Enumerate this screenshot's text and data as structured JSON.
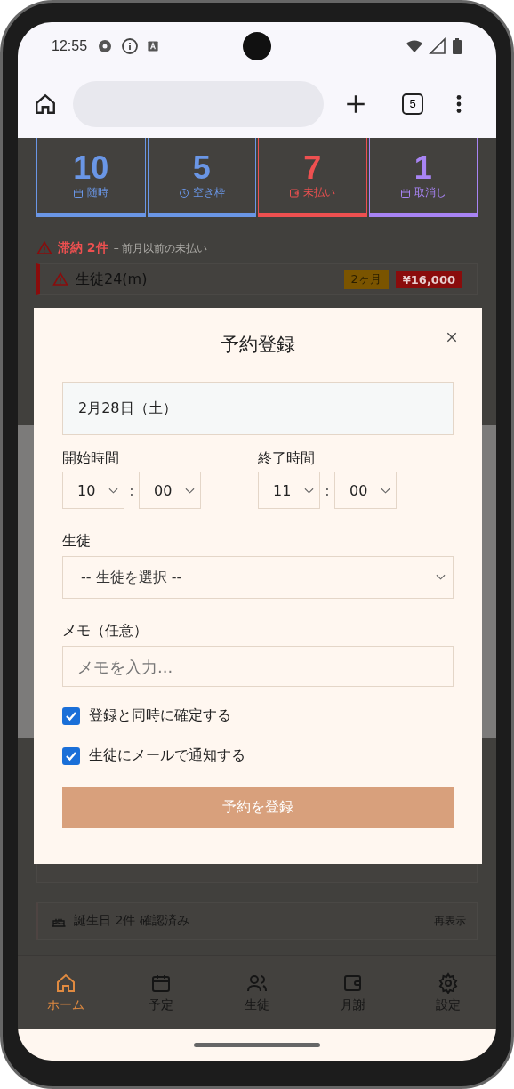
{
  "status_bar": {
    "time": "12:55"
  },
  "browser": {
    "tab_count": "5"
  },
  "stats": [
    {
      "value": "10",
      "label": "随時",
      "color": "#6a96e6"
    },
    {
      "value": "5",
      "label": "空き枠",
      "color": "#6a96e6"
    },
    {
      "value": "7",
      "label": "未払い",
      "color": "#ee5050"
    },
    {
      "value": "1",
      "label": "取消し",
      "color": "#a884f4"
    }
  ],
  "overdue": {
    "title": "滞納 2件",
    "note": "– 前月以前の未払い",
    "rows": [
      {
        "name": "生徒24(m)",
        "months": "2ヶ月",
        "amount": "¥16,000"
      }
    ]
  },
  "birthday": {
    "text": "誕生日 2件 確認済み",
    "action": "再表示"
  },
  "nav": [
    {
      "label": "ホーム",
      "selected": true
    },
    {
      "label": "予定",
      "selected": false
    },
    {
      "label": "生徒",
      "selected": false
    },
    {
      "label": "月謝",
      "selected": false
    },
    {
      "label": "設定",
      "selected": false
    }
  ],
  "modal": {
    "title": "予約登録",
    "date": "2月28日（土）",
    "start": {
      "label": "開始時間",
      "hour": "10",
      "separator": ":",
      "minute": "00"
    },
    "end": {
      "label": "終了時間",
      "hour": "11",
      "separator": ":",
      "minute": "00"
    },
    "student": {
      "label": "生徒",
      "value": "-- 生徒を選択 --"
    },
    "memo": {
      "label": "メモ（任意）",
      "placeholder": "メモを入力..."
    },
    "options": [
      {
        "label": "登録と同時に確定する",
        "checked": true
      },
      {
        "label": "生徒にメールで通知する",
        "checked": true
      }
    ],
    "submit": "予約を登録"
  }
}
